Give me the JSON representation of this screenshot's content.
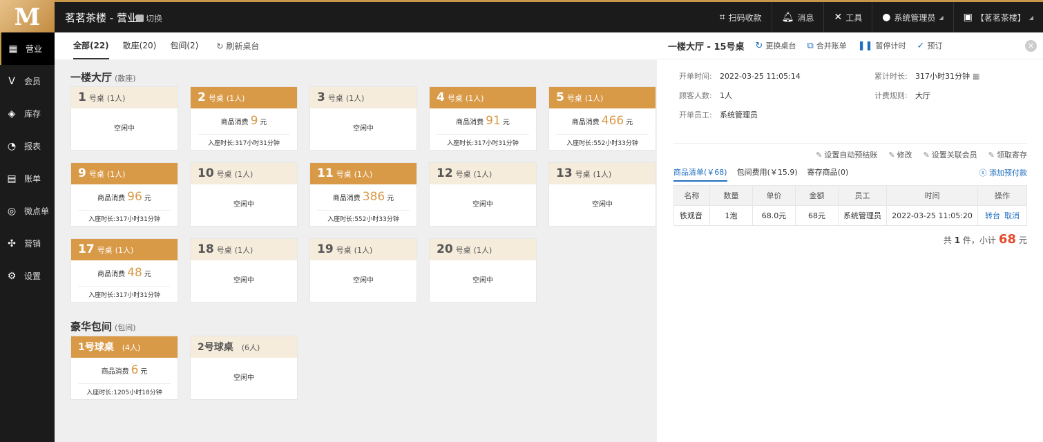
{
  "header": {
    "app_title": "茗茗茶楼 - 营业",
    "switch_label": "切换",
    "items": [
      {
        "name": "scan",
        "label": "扫码收款"
      },
      {
        "name": "message",
        "label": "消息"
      },
      {
        "name": "tools",
        "label": "工具"
      },
      {
        "name": "user",
        "label": "系统管理员"
      },
      {
        "name": "store",
        "label": "【茗茗茶楼】"
      }
    ]
  },
  "sidebar": {
    "items": [
      {
        "label": "营业",
        "active": true
      },
      {
        "label": "会员"
      },
      {
        "label": "库存"
      },
      {
        "label": "报表"
      },
      {
        "label": "账单"
      },
      {
        "label": "微点单"
      },
      {
        "label": "营销"
      },
      {
        "label": "设置"
      }
    ]
  },
  "tabs": {
    "all": "全部(22)",
    "hall": "散座(20)",
    "room": "包间(2)",
    "refresh": "刷新桌台"
  },
  "sections": {
    "hall_title": "一楼大厅",
    "hall_sub": "(散座)",
    "room_title": "豪华包间",
    "room_sub": "(包间)"
  },
  "common": {
    "unit": "号桌",
    "idle": "空闲中",
    "cons_label": "商品消费",
    "yuan": "元",
    "dur_label": "入座时长:"
  },
  "tables": [
    {
      "num": "1",
      "people": "(1人)",
      "busy": false
    },
    {
      "num": "2",
      "people": "(1人)",
      "busy": true,
      "amount": "9",
      "duration": "317小时31分钟"
    },
    {
      "num": "3",
      "people": "(1人)",
      "busy": false
    },
    {
      "num": "4",
      "people": "(1人)",
      "busy": true,
      "amount": "91",
      "duration": "317小时31分钟"
    },
    {
      "num": "5",
      "people": "(1人)",
      "busy": true,
      "amount": "466",
      "duration": "552小时33分钟"
    },
    {
      "num": "9",
      "people": "(1人)",
      "busy": true,
      "amount": "96",
      "duration": "317小时31分钟"
    },
    {
      "num": "10",
      "people": "(1人)",
      "busy": false
    },
    {
      "num": "11",
      "people": "(1人)",
      "busy": true,
      "amount": "386",
      "duration": "552小时33分钟"
    },
    {
      "num": "12",
      "people": "(1人)",
      "busy": false
    },
    {
      "num": "13",
      "people": "(1人)",
      "busy": false
    },
    {
      "num": "17",
      "people": "(1人)",
      "busy": true,
      "amount": "48",
      "duration": "317小时31分钟"
    },
    {
      "num": "18",
      "people": "(1人)",
      "busy": false
    },
    {
      "num": "19",
      "people": "(1人)",
      "busy": false
    },
    {
      "num": "20",
      "people": "(1人)",
      "busy": false
    }
  ],
  "rooms": [
    {
      "name": "1号球桌",
      "people": "(4人)",
      "busy": true,
      "amount": "6",
      "duration": "1205小时18分钟"
    },
    {
      "name": "2号球桌",
      "people": "(6人)",
      "busy": false
    }
  ],
  "panel": {
    "title": "一楼大厅 - 15号桌",
    "buttons": [
      "更换桌台",
      "合并账单",
      "暂停计时",
      "预订"
    ],
    "open_time_label": "开单时间:",
    "open_time": "2022-03-25 11:05:14",
    "guests_label": "顾客人数:",
    "guests": "1人",
    "staff_label": "开单员工:",
    "staff": "系统管理员",
    "total_time_label": "累计时长:",
    "total_time": "317小时31分钟",
    "rule_label": "计费规则:",
    "rule": "大厅",
    "actions": [
      "设置自动预结账",
      "修改",
      "设置关联会员",
      "领取寄存"
    ],
    "subtabs": [
      "商品清单(￥68)",
      "包间费用(￥15.9)",
      "寄存商品(0)"
    ],
    "add_prepay": "添加预付款",
    "columns": [
      "名称",
      "数量",
      "单价",
      "金额",
      "员工",
      "时间",
      "操作"
    ],
    "rows": [
      {
        "name": "铁观音",
        "qty": "1泡",
        "price": "68.0元",
        "amount": "68元",
        "staff": "系统管理员",
        "time": "2022-03-25 11:05:20",
        "op1": "转台",
        "op2": "取消"
      }
    ],
    "total_prefix": "共",
    "total_count": "1",
    "total_mid": "件，小计",
    "total_amount": "68",
    "total_unit": "元"
  }
}
